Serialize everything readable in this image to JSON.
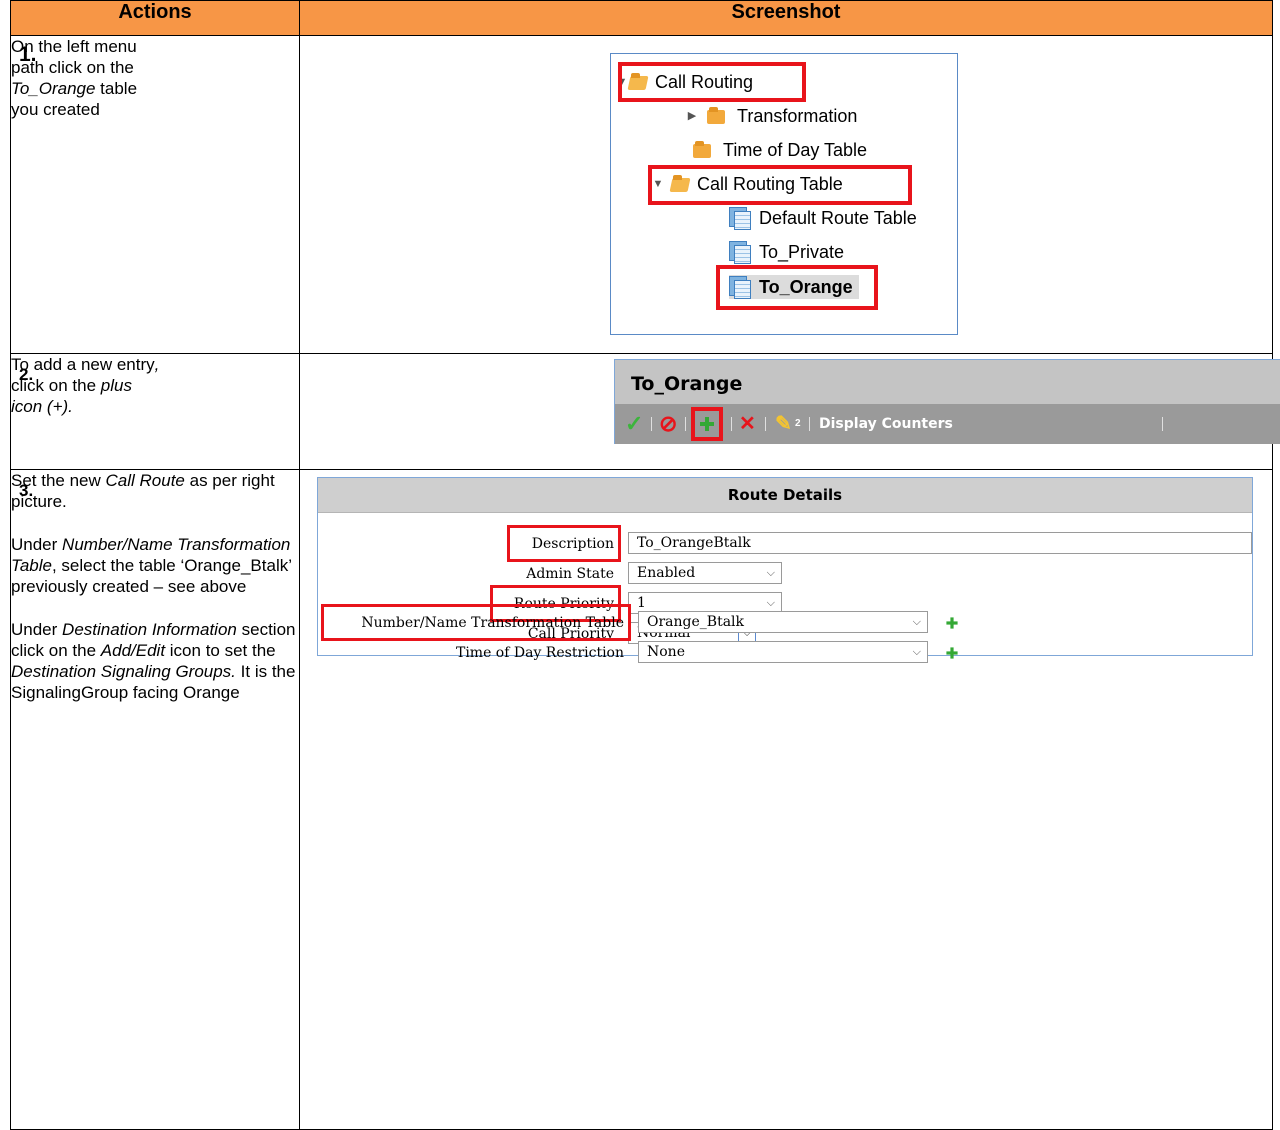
{
  "headers": {
    "actions": "Actions",
    "screenshot": "Screenshot"
  },
  "steps": [
    {
      "number": "1.",
      "lines": [
        "On the left menu",
        "path click on the",
        "table",
        "you created"
      ],
      "em": "To_Orange"
    },
    {
      "number": "2.",
      "text_a": "To add a new entry",
      "comma": ",",
      "text_b": "click on the",
      "em_a": "plus",
      "em_b": "icon (+)."
    },
    {
      "number": "3.",
      "p1_a": "Set the new",
      "p1_em": "Call Route",
      "p1_b": "as per right picture.",
      "p2_a": "Under",
      "p2_em": "Number/Name Transformation Table",
      "p2_b": ", select the table ‘Orange_Btalk’ previously created – see above",
      "p3_a": "Under",
      "p3_em1": "Destination Information",
      "p3_b": "section click on the",
      "p3_em2": "Add/Edit",
      "p3_c": "icon to set the",
      "p3_em3": "Destination Signaling Groups.",
      "p3_d": "It is the SignalingGroup facing Orange"
    }
  ],
  "tree": {
    "items": [
      {
        "label": "Call Routing",
        "icon": "folder-open-icon",
        "expander": "expanded"
      },
      {
        "label": "Transformation",
        "icon": "folder-icon",
        "expander": "collapsed"
      },
      {
        "label": "Time of Day Table",
        "icon": "folder-icon"
      },
      {
        "label": "Call Routing Table",
        "icon": "folder-open-icon",
        "expander": "expanded"
      },
      {
        "label": "Default Route Table",
        "icon": "table-icon"
      },
      {
        "label": "To_Private",
        "icon": "table-icon"
      },
      {
        "label": "To_Orange",
        "icon": "table-icon",
        "selected": true
      }
    ],
    "highlight_color": "#e8141b"
  },
  "toolbar": {
    "title": "To_Orange",
    "apply_icon": "checkmark-icon",
    "cancel_icon": "prohibited-icon",
    "add_icon": "plus-icon",
    "delete_icon": "x-icon",
    "edit_icon": "pencil-icon",
    "edit_sub": "2",
    "display_counters": "Display Counters"
  },
  "form": {
    "title": "Route Details",
    "fields": [
      {
        "label": "Description",
        "value": "To_OrangeBtalk",
        "type": "text"
      },
      {
        "label": "Admin State",
        "value": "Enabled",
        "type": "select"
      },
      {
        "label": "Route Priority",
        "value": "1",
        "type": "select"
      },
      {
        "label": "Call Priority",
        "value": "Normal",
        "type": "select"
      },
      {
        "label": "Number/Name Transformation Table",
        "value": "Orange_Btalk",
        "type": "select",
        "add": true
      },
      {
        "label": "Time of Day Restriction",
        "value": "None",
        "type": "select",
        "add": true
      }
    ]
  },
  "colors": {
    "header_bg": "#f79646",
    "highlight": "#e8141b",
    "plus_green": "#34a835"
  }
}
